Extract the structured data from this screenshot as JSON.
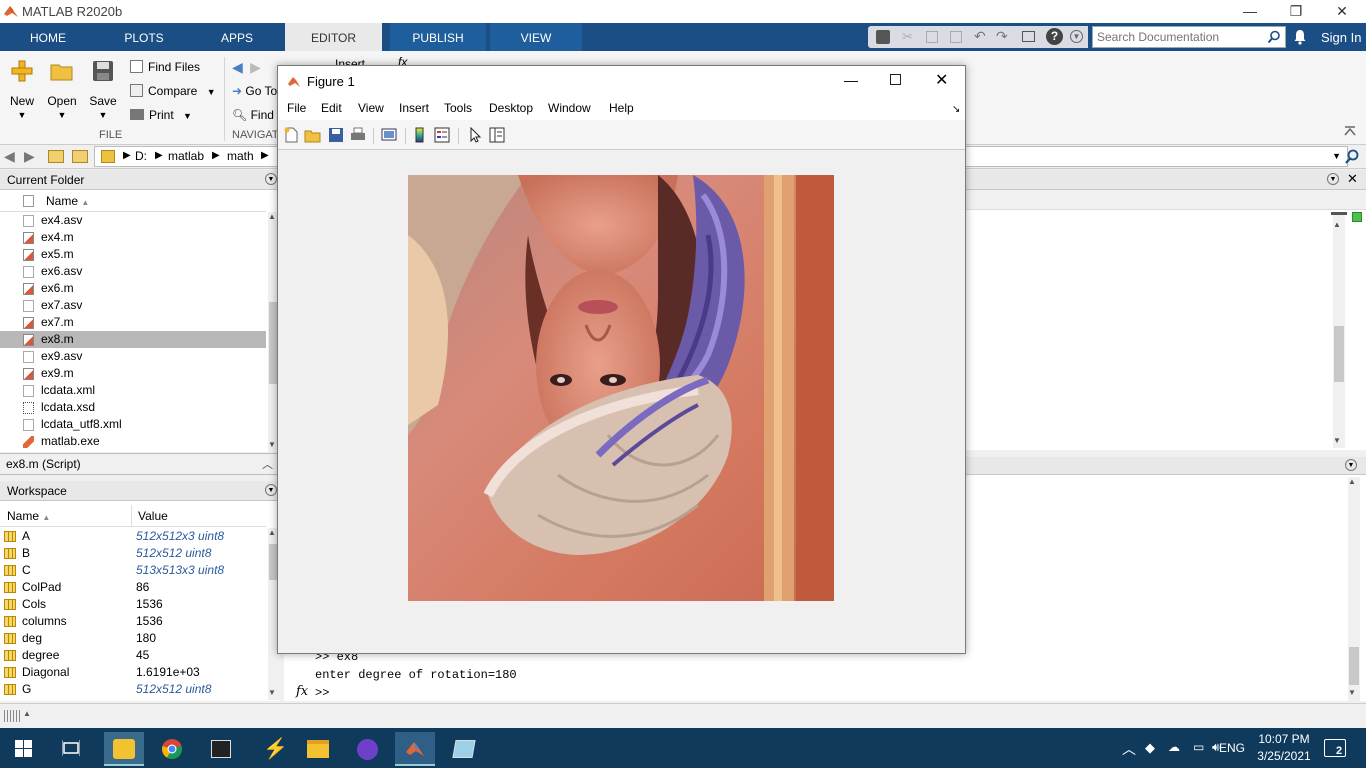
{
  "window": {
    "title": "MATLAB R2020b",
    "min": "—",
    "restore": "❐",
    "close": "✕"
  },
  "tabs": [
    "HOME",
    "PLOTS",
    "APPS",
    "EDITOR",
    "PUBLISH",
    "VIEW"
  ],
  "active_tab": "EDITOR",
  "search": {
    "placeholder": "Search Documentation"
  },
  "sign_in": "Sign In",
  "ribbon": {
    "new": "New",
    "open": "Open",
    "save": "Save",
    "find_files": "Find Files",
    "compare": "Compare",
    "print": "Print",
    "file_group": "FILE",
    "go_to": "Go To",
    "find": "Find",
    "insert": "Insert",
    "fx": "fx",
    "navigate_group": "NAVIGAT"
  },
  "path": [
    "D:",
    "matlab",
    "math"
  ],
  "current_folder": {
    "title": "Current Folder",
    "column": "Name",
    "files": [
      {
        "name": "ex4.asv",
        "type": "asv"
      },
      {
        "name": "ex4.m",
        "type": "m"
      },
      {
        "name": "ex5.m",
        "type": "m"
      },
      {
        "name": "ex6.asv",
        "type": "asv"
      },
      {
        "name": "ex6.m",
        "type": "m"
      },
      {
        "name": "ex7.asv",
        "type": "asv"
      },
      {
        "name": "ex7.m",
        "type": "m"
      },
      {
        "name": "ex8.m",
        "type": "m",
        "selected": true
      },
      {
        "name": "ex9.asv",
        "type": "asv"
      },
      {
        "name": "ex9.m",
        "type": "m"
      },
      {
        "name": "lcdata.xml",
        "type": "xml"
      },
      {
        "name": "lcdata.xsd",
        "type": "xsd"
      },
      {
        "name": "lcdata_utf8.xml",
        "type": "xml"
      },
      {
        "name": "matlab.exe",
        "type": "exe"
      }
    ]
  },
  "script_label": "ex8.m  (Script)",
  "workspace": {
    "title": "Workspace",
    "col_name": "Name",
    "col_value": "Value",
    "vars": [
      {
        "name": "A",
        "value": "512x512x3 uint8",
        "italic": true
      },
      {
        "name": "B",
        "value": "512x512 uint8",
        "italic": true
      },
      {
        "name": "C",
        "value": "513x513x3 uint8",
        "italic": true
      },
      {
        "name": "ColPad",
        "value": "86",
        "italic": false
      },
      {
        "name": "Cols",
        "value": "1536",
        "italic": false
      },
      {
        "name": "columns",
        "value": "1536",
        "italic": false
      },
      {
        "name": "deg",
        "value": "180",
        "italic": false
      },
      {
        "name": "degree",
        "value": "45",
        "italic": false
      },
      {
        "name": "Diagonal",
        "value": "1.6191e+03",
        "italic": false
      },
      {
        "name": "G",
        "value": "512x512 uint8",
        "italic": true
      }
    ]
  },
  "command_window": {
    "lines": [
      ">> ex8",
      "enter degree of rotation=180"
    ],
    "prompt": ">>",
    "fx": "fx"
  },
  "figure": {
    "title": "Figure 1",
    "menu": [
      "File",
      "Edit",
      "View",
      "Insert",
      "Tools",
      "Desktop",
      "Window",
      "Help"
    ],
    "image_desc": "lena-rotated-180"
  },
  "tray": {
    "language": "ENG",
    "time": "10:07 PM",
    "date": "3/25/2021",
    "notifications": "2"
  },
  "colors": {
    "tabbar": "#1a4e84",
    "taskbar": "#103a5c",
    "selection": "#b8b8b8"
  }
}
